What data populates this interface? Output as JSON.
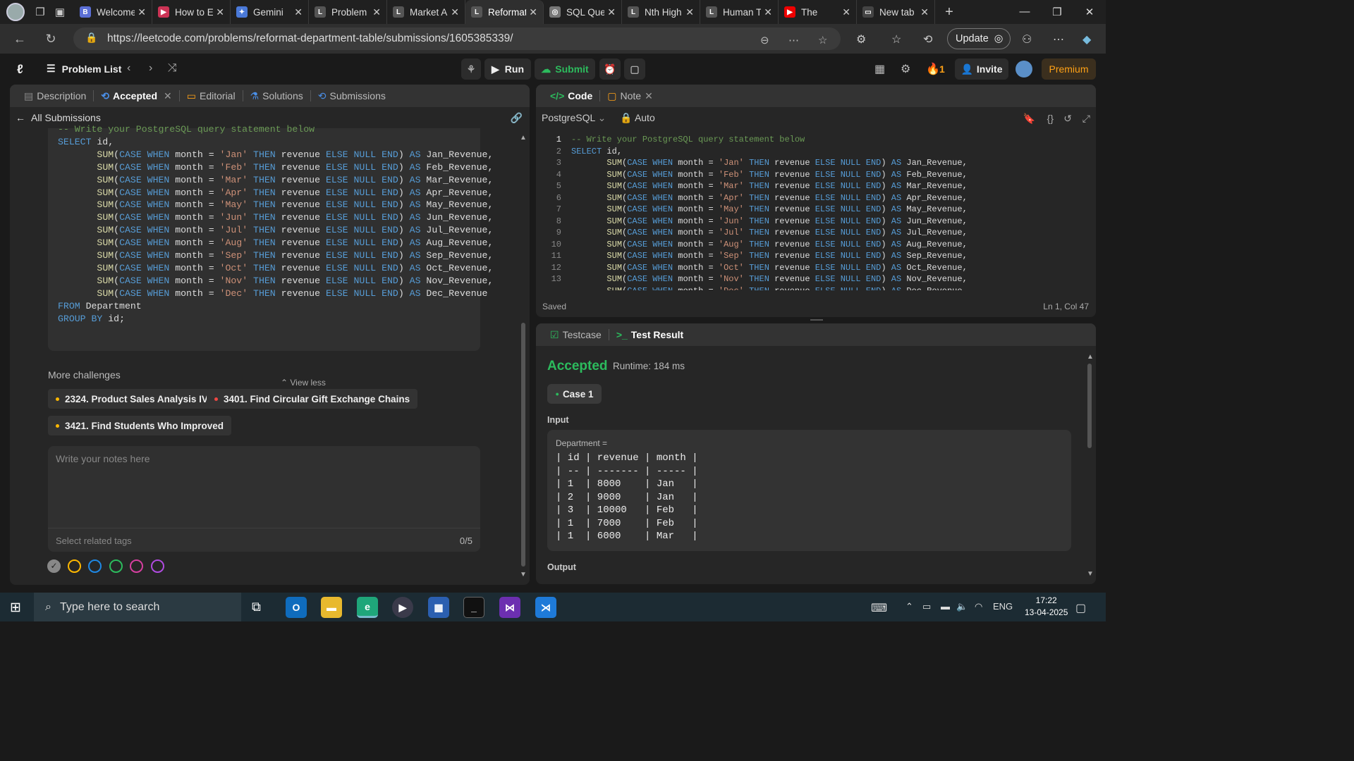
{
  "browser": {
    "tabs": [
      {
        "title": "Welcome",
        "icon": "B",
        "color": "#5b6fd6"
      },
      {
        "title": "How to E",
        "icon": "▶",
        "color": "#cc3355"
      },
      {
        "title": "Gemini",
        "icon": "✦",
        "color": "#4a79d8"
      },
      {
        "title": "Problem",
        "icon": "L",
        "color": "#555"
      },
      {
        "title": "Market A",
        "icon": "L",
        "color": "#555"
      },
      {
        "title": "Reformat",
        "icon": "L",
        "color": "#555"
      },
      {
        "title": "SQL Que",
        "icon": "◎",
        "color": "#777"
      },
      {
        "title": "Nth High",
        "icon": "L",
        "color": "#555"
      },
      {
        "title": "Human T",
        "icon": "L",
        "color": "#555"
      },
      {
        "title": "The",
        "icon": "▶",
        "color": "#e00"
      },
      {
        "title": "New tab",
        "icon": "▭",
        "color": "#444"
      }
    ],
    "url": "https://leetcode.com/problems/reformat-department-table/submissions/1605385339/",
    "update_label": "Update"
  },
  "topnav": {
    "problem_list": "Problem List",
    "run": "Run",
    "submit": "Submit",
    "streak": "1",
    "invite": "Invite",
    "premium": "Premium"
  },
  "left_panel": {
    "tabs": [
      "Description",
      "Accepted",
      "Editorial",
      "Solutions",
      "Submissions"
    ],
    "back_link": "All Submissions",
    "code_lines": [
      "-- Write your PostgreSQL query statement below",
      "SELECT id,",
      "       SUM(CASE WHEN month = 'Jan' THEN revenue ELSE NULL END) AS Jan_Revenue,",
      "       SUM(CASE WHEN month = 'Feb' THEN revenue ELSE NULL END) AS Feb_Revenue,",
      "       SUM(CASE WHEN month = 'Mar' THEN revenue ELSE NULL END) AS Mar_Revenue,",
      "       SUM(CASE WHEN month = 'Apr' THEN revenue ELSE NULL END) AS Apr_Revenue,",
      "       SUM(CASE WHEN month = 'May' THEN revenue ELSE NULL END) AS May_Revenue,",
      "       SUM(CASE WHEN month = 'Jun' THEN revenue ELSE NULL END) AS Jun_Revenue,",
      "       SUM(CASE WHEN month = 'Jul' THEN revenue ELSE NULL END) AS Jul_Revenue,",
      "       SUM(CASE WHEN month = 'Aug' THEN revenue ELSE NULL END) AS Aug_Revenue,",
      "       SUM(CASE WHEN month = 'Sep' THEN revenue ELSE NULL END) AS Sep_Revenue,",
      "       SUM(CASE WHEN month = 'Oct' THEN revenue ELSE NULL END) AS Oct_Revenue,",
      "       SUM(CASE WHEN month = 'Nov' THEN revenue ELSE NULL END) AS Nov_Revenue,",
      "       SUM(CASE WHEN month = 'Dec' THEN revenue ELSE NULL END) AS Dec_Revenue",
      "FROM Department",
      "GROUP BY id;"
    ],
    "view_less": "View less",
    "more_challenges": "More challenges",
    "challenges": [
      {
        "label": "2324. Product Sales Analysis IV",
        "color": "#ffb800"
      },
      {
        "label": "3401. Find Circular Gift Exchange Chains",
        "color": "#ef4743"
      },
      {
        "label": "3421. Find Students Who Improved",
        "color": "#ffb800"
      }
    ],
    "notes_placeholder": "Write your notes here",
    "tags_placeholder": "Select related tags",
    "counter": "0/5",
    "note_colors": [
      "#888",
      "#ffb800",
      "#1e88e5",
      "#2cbb5d",
      "#d63fa0",
      "#b04be0"
    ]
  },
  "code_panel": {
    "tabs": [
      "Code",
      "Note"
    ],
    "language": "PostgreSQL",
    "mode": "Auto",
    "line_numbers": [
      "1",
      "2",
      "3",
      "4",
      "5",
      "6",
      "7",
      "8",
      "9",
      "10",
      "11",
      "12",
      "13"
    ],
    "saved": "Saved",
    "cursor": "Ln 1, Col 47"
  },
  "result_panel": {
    "tabs": [
      "Testcase",
      "Test Result"
    ],
    "status": "Accepted",
    "runtime": "Runtime: 184 ms",
    "case": "Case 1",
    "input_label": "Input",
    "table_name": "Department =",
    "table_lines": [
      "| id | revenue | month |",
      "| -- | ------- | ----- |",
      "| 1  | 8000    | Jan   |",
      "| 2  | 9000    | Jan   |",
      "| 3  | 10000   | Feb   |",
      "| 1  | 7000    | Feb   |",
      "| 1  | 6000    | Mar   |"
    ],
    "output_label": "Output"
  },
  "taskbar": {
    "search_placeholder": "Type here to search",
    "lang": "ENG",
    "time": "17:22",
    "date": "13-04-2025"
  }
}
